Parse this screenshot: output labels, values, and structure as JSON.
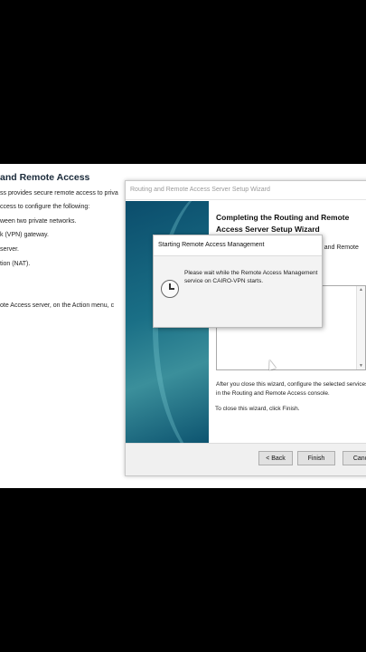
{
  "background_panel": {
    "title": "and Remote Access",
    "lines": [
      "ss provides secure remote access to priva",
      "ccess to configure the following:",
      "ween two private networks.",
      "k (VPN) gateway.",
      "server.",
      "tion (NAT).",
      "ote Access server, on the Action menu, c"
    ]
  },
  "wizard": {
    "title": "Routing and Remote Access Server Setup Wizard",
    "heading": "Completing the Routing and Remote Access Server Setup Wizard",
    "partial_text": "ng and Remote",
    "after_close_text": "After you close this wizard, configure the selected services in the Routing and  Remote Access console.",
    "close_instruction": "To close this wizard, click Finish.",
    "buttons": {
      "back": "< Back",
      "finish": "Finish",
      "cancel": "Canc"
    }
  },
  "modal": {
    "title": "Starting Remote Access Management",
    "message": "Please wait while the Remote Access Management service on CAIRO-VPN starts.",
    "icon": "clock-icon"
  }
}
